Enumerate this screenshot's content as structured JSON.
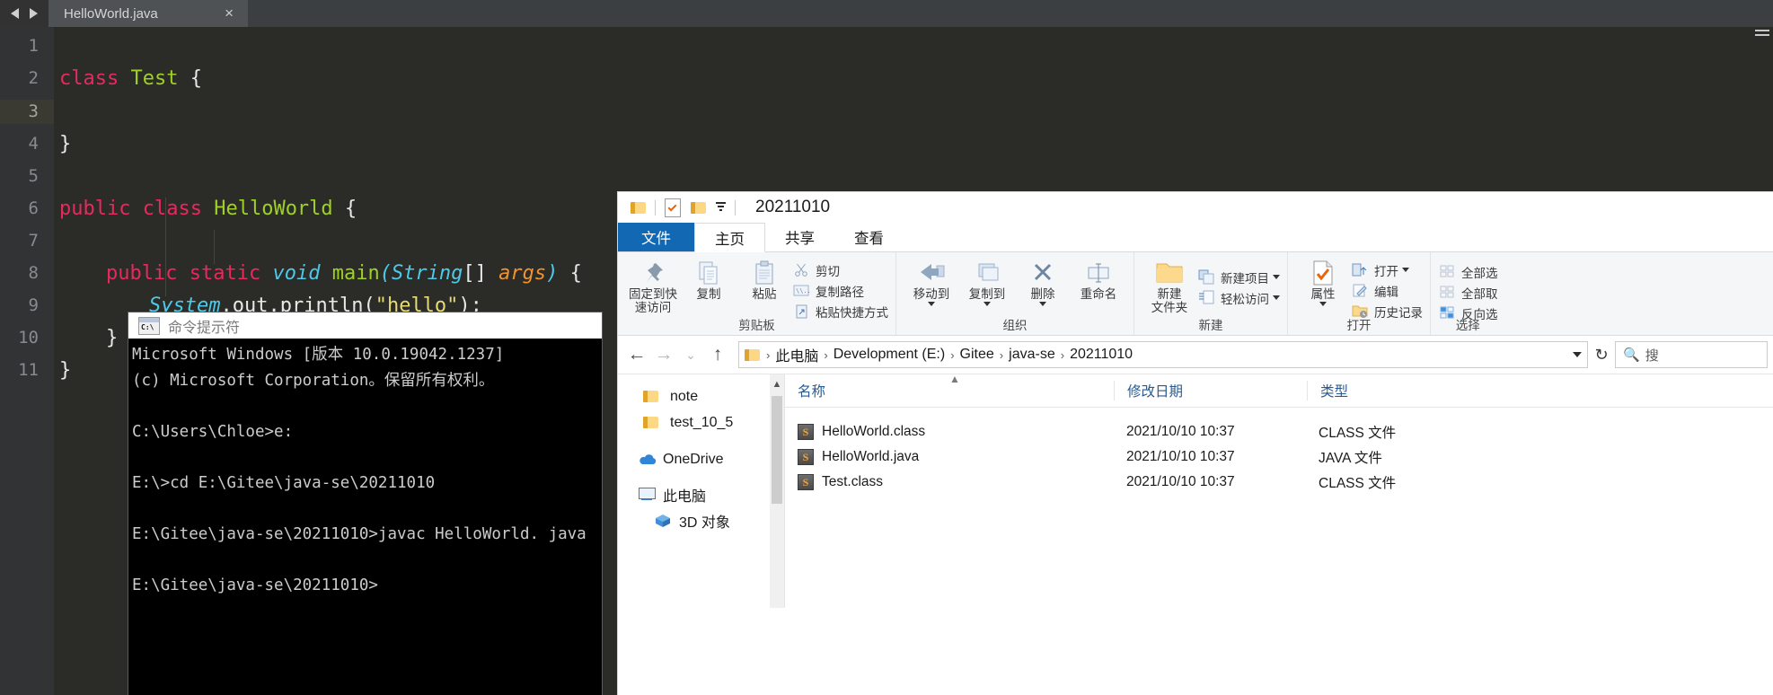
{
  "editor": {
    "tab": {
      "label": "HelloWorld.java",
      "close": "×"
    },
    "nav": {
      "back": "back-arrow",
      "forward": "forward-arrow"
    },
    "current_line": 3,
    "lines": [
      {
        "n": 1,
        "text": ""
      },
      {
        "n": 2,
        "text": "class Test {"
      },
      {
        "n": 3,
        "text": ""
      },
      {
        "n": 4,
        "text": "}"
      },
      {
        "n": 5,
        "text": ""
      },
      {
        "n": 6,
        "text": "public class HelloWorld {"
      },
      {
        "n": 7,
        "text": ""
      },
      {
        "n": 8,
        "text": "    public static void main(String[] args) {"
      },
      {
        "n": 9,
        "text": "        System.out.println(\"hello\");"
      },
      {
        "n": 10,
        "text": "    }"
      },
      {
        "n": 11,
        "text": "}"
      }
    ],
    "tokens": {
      "l2": {
        "kw": "class",
        "cls": "Test",
        "brace": "{"
      },
      "l4": {
        "brace": "}"
      },
      "l6": {
        "kw1": "public",
        "kw2": "class",
        "cls": "HelloWorld",
        "brace": "{"
      },
      "l8": {
        "kw1": "public",
        "kw2": "static",
        "kw3": "void",
        "mth": "main",
        "lp": "(",
        "ty": "String",
        "br": "[]",
        "var": "args",
        "rp": ")",
        "brace": "{"
      },
      "l9": {
        "cls": "System",
        "dot1": ".",
        "fld": "out",
        "dot2": ".",
        "mth": "println",
        "lp": "(",
        "str": "\"hello\"",
        "rp": ")",
        "semi": ";"
      },
      "l10": {
        "brace": "}"
      },
      "l11": {
        "brace": "}"
      }
    },
    "colors": {
      "background": "#2b2b28",
      "gutter": "#313335",
      "keyword": "#e8295d",
      "classname": "#9fd125",
      "type": "#4ec9e8",
      "variable": "#f2922d",
      "string": "#e6db74",
      "plain": "#e8e8e8"
    }
  },
  "cmd": {
    "title": "命令提示符",
    "icon_text": "C:\\",
    "lines": [
      "Microsoft Windows [版本 10.0.19042.1237]",
      "(c) Microsoft Corporation。保留所有权利。",
      "",
      "C:\\Users\\Chloe>e:",
      "",
      "E:\\>cd E:\\Gitee\\java-se\\20211010",
      "",
      "E:\\Gitee\\java-se\\20211010>javac HelloWorld. java",
      "",
      "E:\\Gitee\\java-se\\20211010>"
    ]
  },
  "explorer": {
    "quick_access": {
      "title": "20211010"
    },
    "ribbon_tabs": [
      {
        "label": "文件",
        "state": "file"
      },
      {
        "label": "主页",
        "state": "active"
      },
      {
        "label": "共享",
        "state": "normal"
      },
      {
        "label": "查看",
        "state": "normal"
      }
    ],
    "ribbon_groups": [
      {
        "name": "clipboard",
        "label": "剪贴板",
        "big": [
          {
            "label": "固定到快\n速访问",
            "line1": "固定到快",
            "line2": "速访问",
            "icon": "pin-icon"
          },
          {
            "label": "复制",
            "line1": "复制",
            "line2": "",
            "icon": "copy-icon"
          },
          {
            "label": "粘贴",
            "line1": "粘贴",
            "line2": "",
            "icon": "paste-icon"
          }
        ],
        "small": [
          {
            "label": "剪切",
            "icon": "scissors-icon"
          },
          {
            "label": "复制路径",
            "icon": "copy-path-icon"
          },
          {
            "label": "粘贴快捷方式",
            "icon": "paste-shortcut-icon"
          }
        ]
      },
      {
        "name": "organize",
        "label": "组织",
        "big": [
          {
            "line1": "移动到",
            "line2": "",
            "icon": "move-to-icon",
            "dropdown": true
          },
          {
            "line1": "复制到",
            "line2": "",
            "icon": "copy-to-icon",
            "dropdown": true
          },
          {
            "line1": "删除",
            "line2": "",
            "icon": "delete-icon",
            "dropdown": true
          },
          {
            "line1": "重命名",
            "line2": "",
            "icon": "rename-icon",
            "dropdown": false
          }
        ],
        "small": []
      },
      {
        "name": "new",
        "label": "新建",
        "big": [
          {
            "line1": "新建",
            "line2": "文件夹",
            "icon": "new-folder-icon"
          }
        ],
        "small": [
          {
            "label": "新建项目",
            "icon": "new-item-icon",
            "dropdown": true
          },
          {
            "label": "轻松访问",
            "icon": "easy-access-icon",
            "dropdown": true
          }
        ]
      },
      {
        "name": "open",
        "label": "打开",
        "big": [
          {
            "line1": "属性",
            "line2": "",
            "icon": "properties-icon",
            "dropdown": true
          }
        ],
        "small": [
          {
            "label": "打开",
            "icon": "open-icon",
            "dropdown": true
          },
          {
            "label": "编辑",
            "icon": "edit-icon"
          },
          {
            "label": "历史记录",
            "icon": "history-icon"
          }
        ]
      },
      {
        "name": "select",
        "label": "选择",
        "big": [],
        "small": [
          {
            "label": "全部选",
            "icon": "select-all-icon"
          },
          {
            "label": "全部取",
            "icon": "select-none-icon"
          },
          {
            "label": "反向选",
            "icon": "invert-selection-icon"
          }
        ]
      }
    ],
    "address": {
      "back": "←",
      "forward": "→",
      "recent": "⌄",
      "up": "↑",
      "crumbs": [
        "此电脑",
        "Development (E:)",
        "Gitee",
        "java-se",
        "20211010"
      ],
      "separator": "›",
      "refresh": "↻",
      "search_placeholder": "搜"
    },
    "nav_pane": [
      {
        "label": "note",
        "icon": "folder-icon"
      },
      {
        "label": "test_10_5",
        "icon": "folder-icon"
      },
      {
        "label": "OneDrive",
        "icon": "onedrive-icon"
      },
      {
        "label": "此电脑",
        "icon": "this-pc-icon"
      },
      {
        "label": "3D 对象",
        "icon": "3d-objects-icon"
      }
    ],
    "columns": [
      "名称",
      "修改日期",
      "类型"
    ],
    "files": [
      {
        "name": "HelloWorld.class",
        "modified": "2021/10/10 10:37",
        "type": "CLASS 文件",
        "icon": "java-file-icon"
      },
      {
        "name": "HelloWorld.java",
        "modified": "2021/10/10 10:37",
        "type": "JAVA 文件",
        "icon": "java-file-icon"
      },
      {
        "name": "Test.class",
        "modified": "2021/10/10 10:37",
        "type": "CLASS 文件",
        "icon": "java-file-icon"
      }
    ]
  }
}
